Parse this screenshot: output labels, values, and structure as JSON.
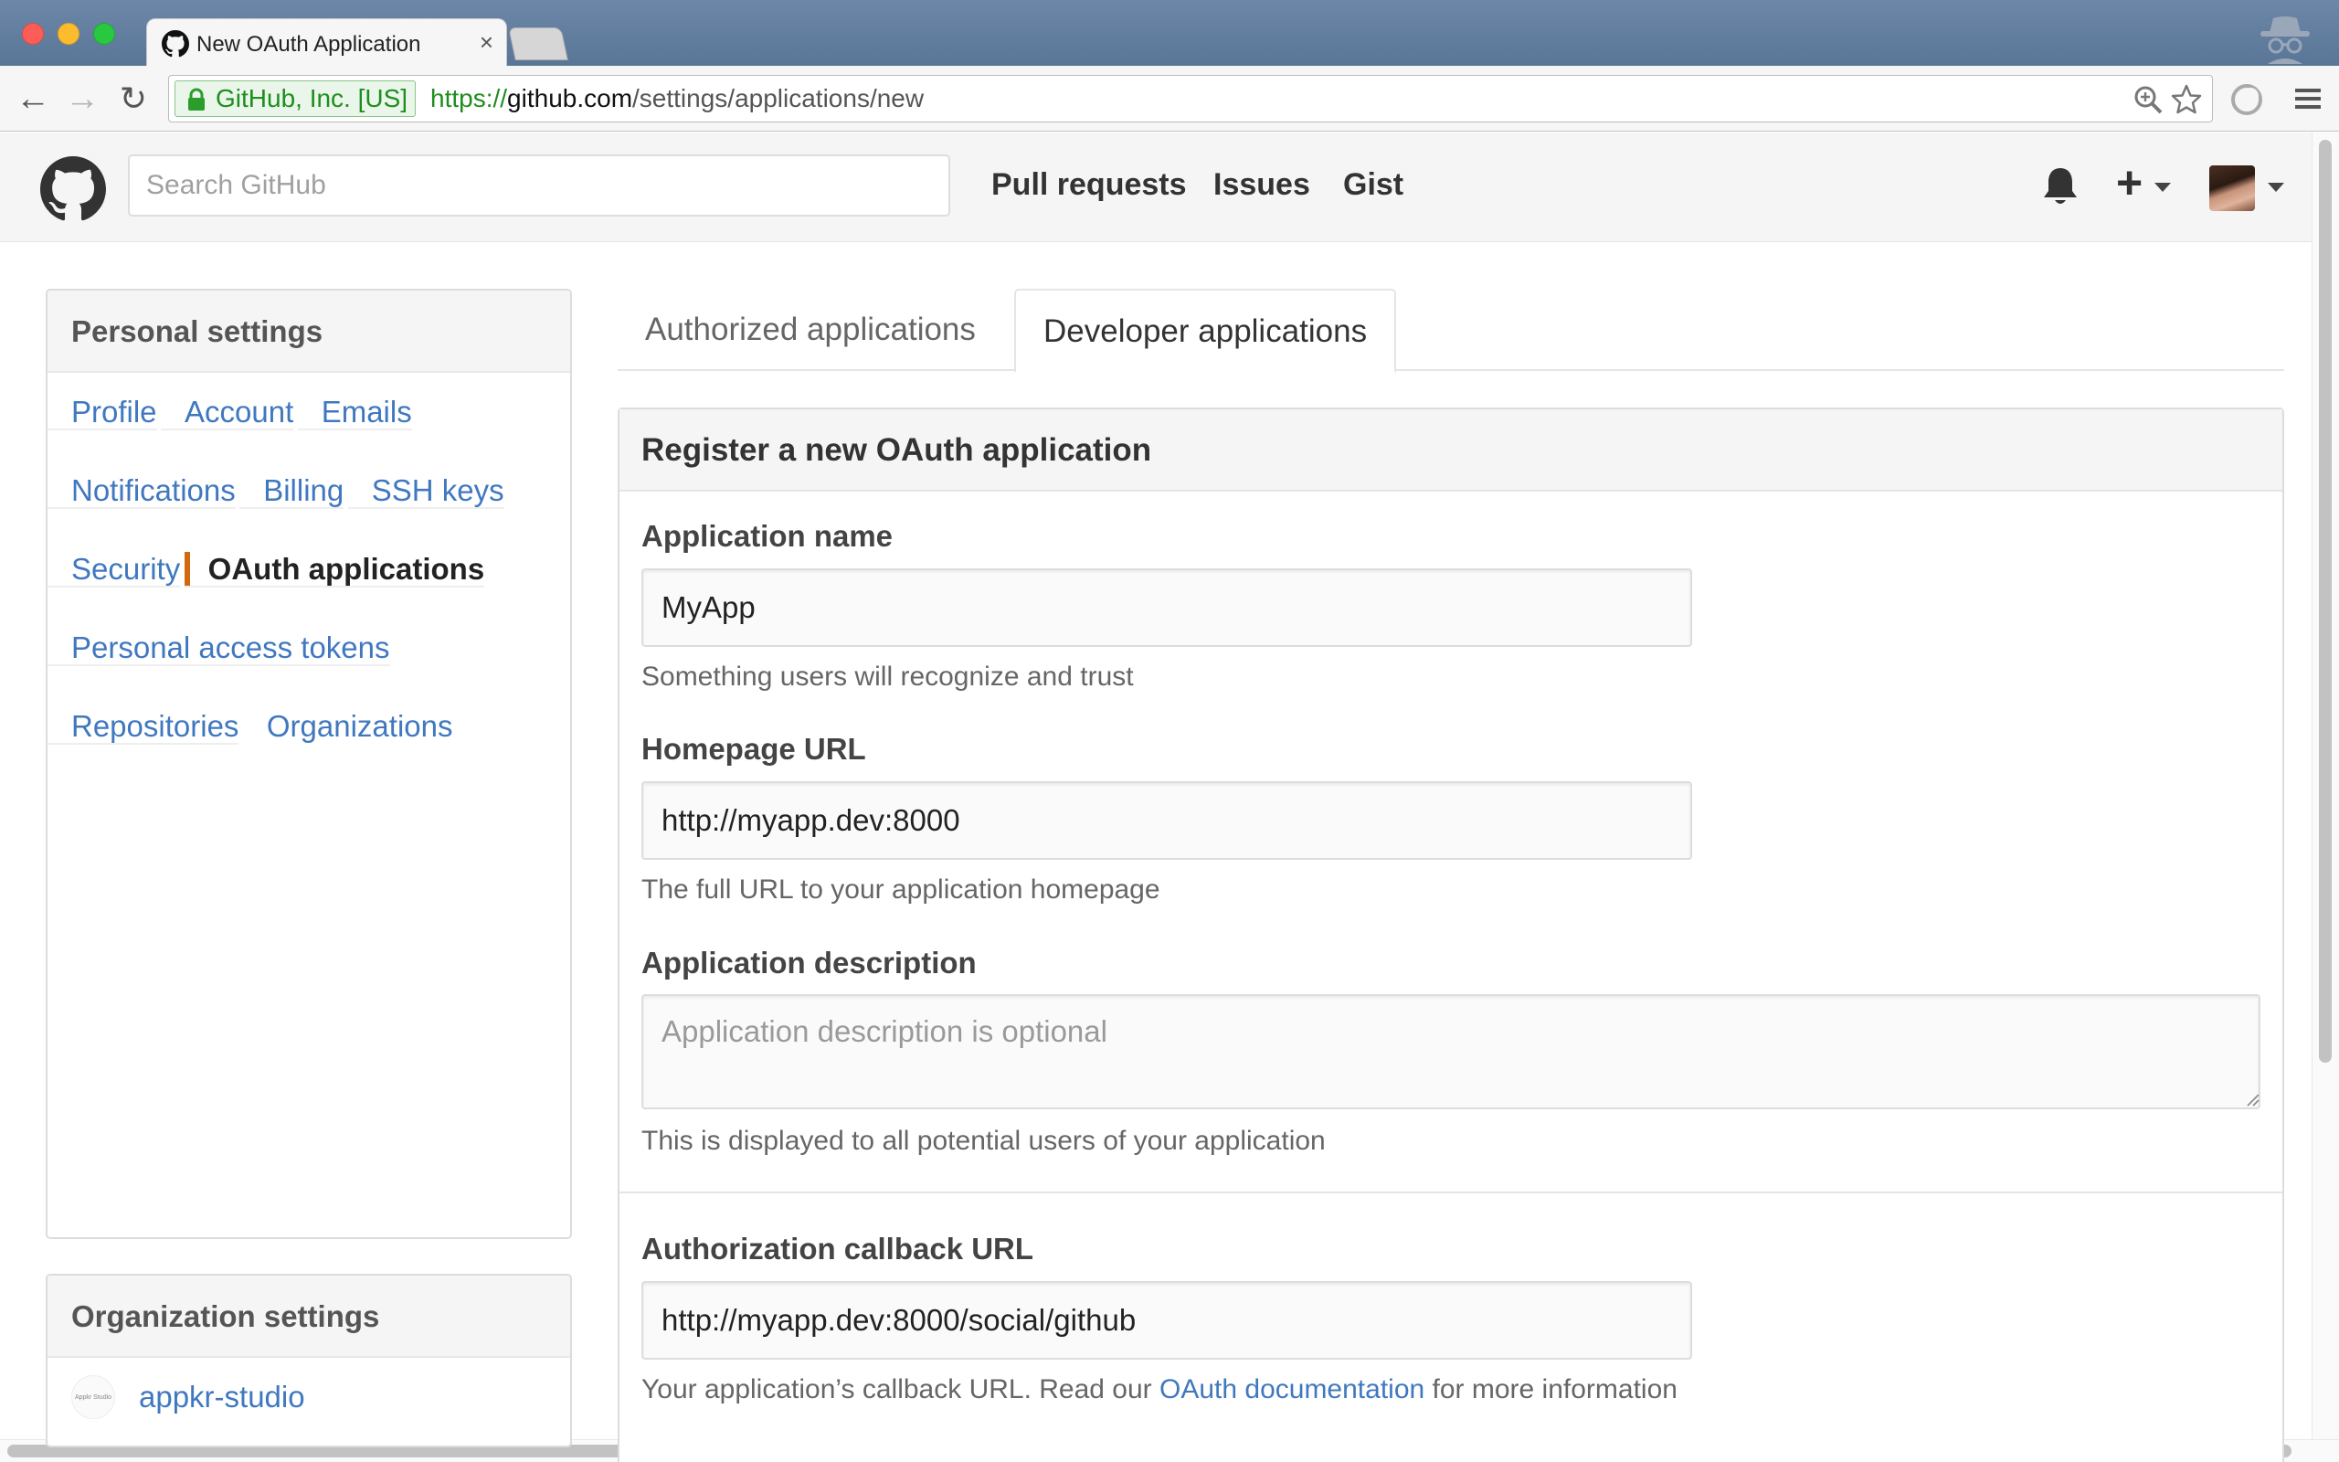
{
  "browser": {
    "tab_title": "New OAuth Application",
    "tab_close": "×",
    "ev_label": "GitHub, Inc. [US]",
    "url_scheme": "https://",
    "url_host": "github.com",
    "url_path": "/settings/applications/new"
  },
  "header": {
    "search_placeholder": "Search GitHub",
    "nav": [
      "Pull requests",
      "Issues",
      "Gist"
    ],
    "plus": "+"
  },
  "sidebar": {
    "personal_heading": "Personal settings",
    "items": [
      {
        "label": "Profile"
      },
      {
        "label": "Account"
      },
      {
        "label": "Emails"
      },
      {
        "label": "Notifications"
      },
      {
        "label": "Billing"
      },
      {
        "label": "SSH keys"
      },
      {
        "label": "Security"
      },
      {
        "label": "OAuth applications",
        "selected": true
      },
      {
        "label": "Personal access tokens"
      },
      {
        "label": "Repositories"
      },
      {
        "label": "Organizations"
      }
    ],
    "org_heading": "Organization settings",
    "org_items": [
      {
        "label": "appkr-studio",
        "logo_text": "Appkr Studio"
      }
    ]
  },
  "tabs": [
    "Authorized applications",
    "Developer applications"
  ],
  "active_tab": "Developer applications",
  "form": {
    "title": "Register a new OAuth application",
    "app_name": {
      "label": "Application name",
      "value": "MyApp",
      "note": "Something users will recognize and trust"
    },
    "homepage": {
      "label": "Homepage URL",
      "value": "http://myapp.dev:8000",
      "note": "The full URL to your application homepage"
    },
    "description": {
      "label": "Application description",
      "placeholder": "Application description is optional",
      "note": "This is displayed to all potential users of your application"
    },
    "callback": {
      "label": "Authorization callback URL",
      "value": "http://myapp.dev:8000/social/github",
      "note_before": "Your application’s callback URL. Read our ",
      "note_link": "OAuth documentation",
      "note_after": " for more information"
    }
  },
  "colors": {
    "link": "#4078c0",
    "selected_marker": "#d26911",
    "ev_green": "#1e8e1e"
  }
}
